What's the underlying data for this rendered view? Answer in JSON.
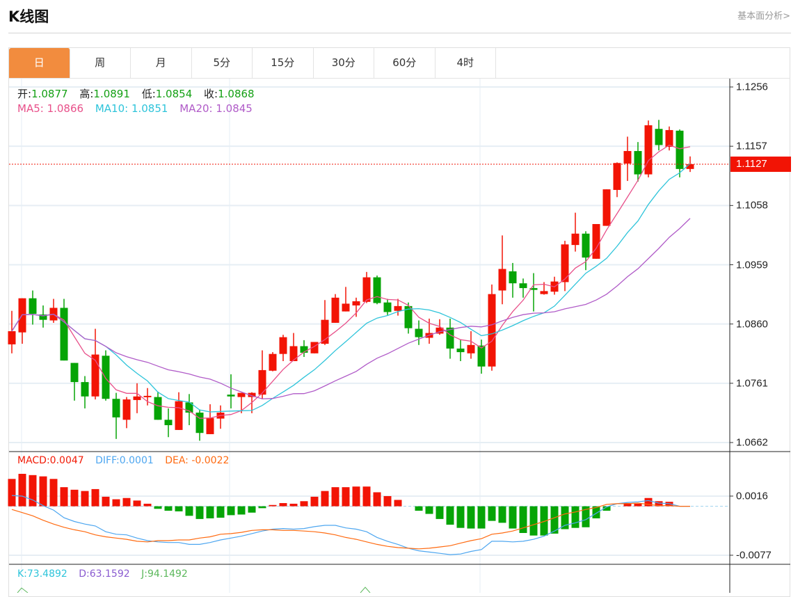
{
  "header": {
    "title": "K线图",
    "link": "基本面分析>"
  },
  "tabs": [
    {
      "label": "日",
      "active": true
    },
    {
      "label": "周"
    },
    {
      "label": "月"
    },
    {
      "label": "5分"
    },
    {
      "label": "15分"
    },
    {
      "label": "30分"
    },
    {
      "label": "60分"
    },
    {
      "label": "4时"
    }
  ],
  "info": {
    "open_label": "开:",
    "open": "1.0877",
    "high_label": "高:",
    "high": "1.0891",
    "low_label": "低:",
    "low": "1.0854",
    "close_label": "收:",
    "close": "1.0868",
    "ma5": "MA5: 1.0866",
    "ma10": "MA10: 1.0851",
    "ma20": "MA20: 1.0845"
  },
  "macd_info": {
    "macd": "MACD:0.0047",
    "diff": "DIFF:0.0001",
    "dea": "DEA: -0.0022"
  },
  "kdj_info": {
    "k": "K:73.4892",
    "d": "D:63.1592",
    "j": "J:94.1492"
  },
  "colors": {
    "up": "#f21405",
    "down": "#06a406",
    "ma5": "#e8508a",
    "ma10": "#2ec4da",
    "ma20": "#b05bc8",
    "diff": "#4da6f0",
    "dea": "#ff6a10",
    "accent": "#f28c3e"
  },
  "chart_data": {
    "type": "candlestick",
    "title": "K线图",
    "price_axis": {
      "range": [
        1.0662,
        1.1256
      ],
      "ticks": [
        "1.1256",
        "1.1157",
        "1.1058",
        "1.0959",
        "1.0860",
        "1.0761",
        "1.0662"
      ]
    },
    "last_price": "1.1127",
    "candles_ohlc": [
      [
        1.0826,
        1.0882,
        1.0811,
        1.0848
      ],
      [
        1.0846,
        1.0903,
        1.0827,
        1.0903
      ],
      [
        1.0903,
        1.0916,
        1.0859,
        1.0877
      ],
      [
        1.0876,
        1.0891,
        1.0854,
        1.0867
      ],
      [
        1.0866,
        1.0902,
        1.0862,
        1.0887
      ],
      [
        1.0887,
        1.0902,
        1.0799,
        1.0799
      ],
      [
        1.0795,
        1.0795,
        1.0732,
        1.0763
      ],
      [
        1.0763,
        1.0773,
        1.0719,
        1.0739
      ],
      [
        1.0739,
        1.0852,
        1.0734,
        1.0809
      ],
      [
        1.0807,
        1.0816,
        1.0732,
        1.0735
      ],
      [
        1.0735,
        1.0745,
        1.0668,
        1.0704
      ],
      [
        1.07,
        1.0738,
        1.0686,
        1.0734
      ],
      [
        1.0733,
        1.0761,
        1.0711,
        1.0739
      ],
      [
        1.0738,
        1.0753,
        1.0724,
        1.074
      ],
      [
        1.0738,
        1.0747,
        1.07,
        1.07
      ],
      [
        1.07,
        1.0719,
        1.0671,
        1.0691
      ],
      [
        1.0683,
        1.0746,
        1.0683,
        1.0731
      ],
      [
        1.0729,
        1.0743,
        1.0691,
        1.0712
      ],
      [
        1.0712,
        1.0717,
        1.0665,
        1.0678
      ],
      [
        1.0676,
        1.0726,
        1.0676,
        1.0703
      ],
      [
        1.0702,
        1.0724,
        1.0685,
        1.0712
      ],
      [
        1.0742,
        1.0776,
        1.0719,
        1.0739
      ],
      [
        1.0738,
        1.0745,
        1.0711,
        1.0745
      ],
      [
        1.0738,
        1.0746,
        1.0711,
        1.0745
      ],
      [
        1.0742,
        1.0816,
        1.0735,
        1.0783
      ],
      [
        1.0782,
        1.0813,
        1.0781,
        1.081
      ],
      [
        1.081,
        1.0842,
        1.0798,
        1.0838
      ],
      [
        1.0798,
        1.0845,
        1.0798,
        1.0823
      ],
      [
        1.0823,
        1.0833,
        1.0805,
        1.0812
      ],
      [
        1.0811,
        1.083,
        1.0811,
        1.083
      ],
      [
        1.0827,
        1.09,
        1.0825,
        1.0867
      ],
      [
        1.0862,
        1.091,
        1.0862,
        1.0904
      ],
      [
        1.0881,
        1.0922,
        1.0881,
        1.0894
      ],
      [
        1.0891,
        1.0904,
        1.0872,
        1.0898
      ],
      [
        1.0897,
        1.0947,
        1.0895,
        1.0938
      ],
      [
        1.0938,
        1.0941,
        1.0893,
        1.0895
      ],
      [
        1.0896,
        1.0902,
        1.0875,
        1.088
      ],
      [
        1.0882,
        1.0902,
        1.0874,
        1.089
      ],
      [
        1.089,
        1.0896,
        1.0844,
        1.0853
      ],
      [
        1.0852,
        1.0866,
        1.0825,
        1.0838
      ],
      [
        1.0837,
        1.0869,
        1.0827,
        1.0845
      ],
      [
        1.0844,
        1.0868,
        1.0842,
        1.0854
      ],
      [
        1.0854,
        1.0869,
        1.0802,
        1.0819
      ],
      [
        1.0819,
        1.0834,
        1.0798,
        1.0813
      ],
      [
        1.0811,
        1.0848,
        1.0802,
        1.0825
      ],
      [
        1.0824,
        1.0834,
        1.0777,
        1.0789
      ],
      [
        1.0789,
        1.0926,
        1.0782,
        1.091
      ],
      [
        1.0916,
        1.1008,
        1.0893,
        1.0952
      ],
      [
        1.0948,
        1.0962,
        1.0904,
        1.0928
      ],
      [
        1.0928,
        1.0936,
        1.0904,
        1.092
      ],
      [
        1.092,
        1.0945,
        1.0881,
        1.0917
      ],
      [
        1.091,
        1.093,
        1.0909,
        1.0915
      ],
      [
        1.0914,
        1.0939,
        1.0909,
        1.0931
      ],
      [
        1.093,
        1.0999,
        1.0915,
        1.0993
      ],
      [
        1.0992,
        1.1046,
        1.0981,
        1.1011
      ],
      [
        1.1011,
        1.1015,
        1.095,
        1.0971
      ],
      [
        1.0969,
        1.1027,
        1.0969,
        1.1027
      ],
      [
        1.1024,
        1.1085,
        1.1024,
        1.1085
      ],
      [
        1.1084,
        1.113,
        1.1072,
        1.1129
      ],
      [
        1.1128,
        1.1173,
        1.1099,
        1.1149
      ],
      [
        1.1149,
        1.1164,
        1.1098,
        1.111
      ],
      [
        1.111,
        1.12,
        1.1105,
        1.1192
      ],
      [
        1.1186,
        1.1201,
        1.115,
        1.1159
      ],
      [
        1.1156,
        1.119,
        1.115,
        1.1184
      ],
      [
        1.1183,
        1.1185,
        1.1105,
        1.1119
      ],
      [
        1.1119,
        1.114,
        1.1114,
        1.1127
      ]
    ],
    "macd_axis": {
      "ticks": [
        "0.0016",
        "-0.0077"
      ]
    },
    "macd": [
      0.0043,
      0.0051,
      0.0049,
      0.0047,
      0.0043,
      0.003,
      0.0026,
      0.0024,
      0.0027,
      0.0015,
      0.0011,
      0.0013,
      0.0009,
      0.0004,
      -0.0004,
      -0.0007,
      -0.0008,
      -0.0015,
      -0.002,
      -0.0019,
      -0.0018,
      -0.0014,
      -0.0013,
      -0.001,
      -0.0003,
      0.0002,
      0.0005,
      0.0004,
      0.0008,
      0.0015,
      0.0024,
      0.003,
      0.003,
      0.0031,
      0.0031,
      0.0022,
      0.0016,
      0.001,
      0.0,
      -0.0007,
      -0.0012,
      -0.002,
      -0.0029,
      -0.0034,
      -0.0035,
      -0.0035,
      -0.0023,
      -0.0026,
      -0.0035,
      -0.0042,
      -0.0046,
      -0.0046,
      -0.0043,
      -0.0036,
      -0.0034,
      -0.0033,
      -0.0019,
      -0.0007,
      0.0,
      0.0005,
      0.0004,
      0.0013,
      0.0008,
      0.0007,
      0.0,
      0.0
    ],
    "diff": [
      0.0017,
      0.0016,
      0.001,
      0.0001,
      -0.0006,
      -0.0018,
      -0.0024,
      -0.0028,
      -0.0031,
      -0.004,
      -0.0044,
      -0.0045,
      -0.005,
      -0.0054,
      -0.0056,
      -0.0057,
      -0.0057,
      -0.006,
      -0.006,
      -0.0057,
      -0.0053,
      -0.005,
      -0.0047,
      -0.0043,
      -0.0039,
      -0.0036,
      -0.0035,
      -0.0036,
      -0.0035,
      -0.0032,
      -0.003,
      -0.003,
      -0.0034,
      -0.0036,
      -0.004,
      -0.0049,
      -0.0055,
      -0.006,
      -0.0066,
      -0.007,
      -0.0072,
      -0.0074,
      -0.0076,
      -0.0075,
      -0.0071,
      -0.0068,
      -0.0055,
      -0.0055,
      -0.0056,
      -0.0055,
      -0.0052,
      -0.0047,
      -0.0039,
      -0.003,
      -0.0026,
      -0.0021,
      -0.0011,
      -0.0001,
      0.0004,
      0.0006,
      0.0007,
      0.0009,
      0.0005,
      0.0004,
      0.0,
      0.0
    ],
    "dea": [
      -0.0005,
      -0.001,
      -0.0015,
      -0.0022,
      -0.0028,
      -0.0033,
      -0.0037,
      -0.004,
      -0.0045,
      -0.0048,
      -0.005,
      -0.0052,
      -0.0055,
      -0.0056,
      -0.0054,
      -0.0054,
      -0.0053,
      -0.0053,
      -0.005,
      -0.0048,
      -0.0044,
      -0.0043,
      -0.0041,
      -0.0038,
      -0.0037,
      -0.0037,
      -0.0038,
      -0.0038,
      -0.0039,
      -0.004,
      -0.0042,
      -0.0045,
      -0.0049,
      -0.0052,
      -0.0056,
      -0.006,
      -0.0063,
      -0.0065,
      -0.0066,
      -0.0067,
      -0.0066,
      -0.0064,
      -0.0062,
      -0.0058,
      -0.0054,
      -0.0051,
      -0.0044,
      -0.0042,
      -0.0039,
      -0.0034,
      -0.0029,
      -0.0024,
      -0.0018,
      -0.0012,
      -0.0009,
      -0.0005,
      -0.0002,
      0.0003,
      0.0004,
      0.0004,
      0.0005,
      0.0003,
      0.0001,
      0.0001,
      0.0,
      0.0
    ]
  }
}
